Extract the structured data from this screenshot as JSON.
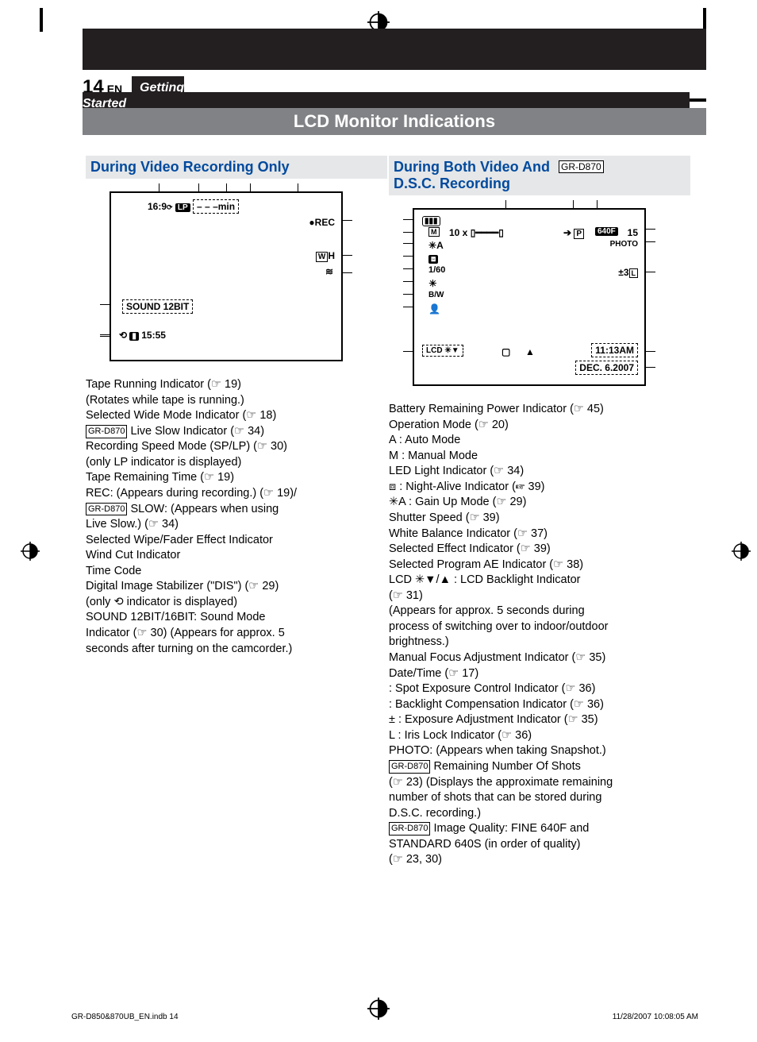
{
  "page": {
    "num": "14",
    "lang": "EN",
    "crumb": "Getting Started"
  },
  "title": "LCD Monitor Indications",
  "left": {
    "heading": "During Video Recording Only",
    "lcd": {
      "row1": "16:9",
      "lp": "LP",
      "min": "– – –min",
      "rec": "REC",
      "wh": "W",
      "h": "H",
      "sound": "SOUND  12BIT",
      "time": "15:55"
    },
    "lines": [
      "Tape Running Indicator (☞ 19)",
      "(Rotates while tape is running.)",
      "Selected Wide Mode Indicator (☞ 18)",
      "[GR-D870] Live Slow Indicator (☞ 34)",
      "Recording Speed Mode (SP/LP) (☞ 30)",
      "(only LP indicator is displayed)",
      "Tape Remaining Time (☞ 19)",
      "REC: (Appears during recording.) (☞ 19)/",
      "[GR-D870] SLOW: (Appears when using",
      "Live Slow.) (☞ 34)",
      "Selected Wipe/Fader Effect Indicator",
      "Wind Cut Indicator",
      "Time Code",
      "Digital Image Stabilizer (\"DIS\") (☞ 29)",
      "(only ⟲ indicator is displayed)",
      "SOUND 12BIT/16BIT: Sound Mode",
      "Indicator (☞ 30) (Appears for approx. 5",
      "seconds after turning on the camcorder.)"
    ]
  },
  "right": {
    "heading_a": "During Both Video And",
    "heading_badge": "GR-D870",
    "heading_b": "D.S.C. Recording",
    "lcd": {
      "m": "M",
      "a": "A",
      "zoom": "10 x",
      "p": "P",
      "q": "640F",
      "shots": "15",
      "photo": "PHOTO",
      "shutter": "1/60",
      "exp": "±3",
      "bw": "B/W",
      "lcd": "LCD",
      "clock": "11:13AM",
      "date": "DEC.  6.2007"
    },
    "lines": [
      "Battery Remaining Power Indicator (☞ 45)",
      "Operation Mode (☞ 20)",
      "A : Auto Mode",
      "M : Manual Mode",
      "LED Light Indicator (☞ 34)",
      "⧈ : Night-Alive Indicator (☞ 39)",
      "✳A : Gain Up Mode (☞ 29)",
      "Shutter Speed (☞ 39)",
      "White Balance Indicator (☞ 37)",
      "Selected Effect Indicator (☞ 39)",
      "Selected Program AE Indicator (☞ 38)",
      "LCD ✳▼/▲ : LCD Backlight Indicator",
      "(☞ 31)",
      "(Appears for approx. 5 seconds during",
      "process of switching over to indoor/outdoor",
      "brightness.)",
      "Manual Focus Adjustment Indicator (☞ 35)",
      "Date/Time (☞ 17)",
      "    : Spot Exposure Control Indicator (☞ 36)",
      "    : Backlight Compensation Indicator (☞ 36)",
      "± : Exposure Adjustment Indicator (☞ 35)",
      "L : Iris Lock Indicator (☞ 36)",
      "PHOTO: (Appears when taking Snapshot.)",
      "[GR-D870] Remaining Number Of Shots",
      "(☞ 23) (Displays the approximate remaining",
      "number of shots that can be stored during",
      "D.S.C. recording.)",
      "[GR-D870] Image Quality: FINE 640F and",
      "STANDARD 640S (in order of quality)",
      "(☞ 23, 30)"
    ]
  },
  "footer": {
    "file": "GR-D850&870UB_EN.indb   14",
    "stamp": "11/28/2007   10:08:05 AM"
  }
}
